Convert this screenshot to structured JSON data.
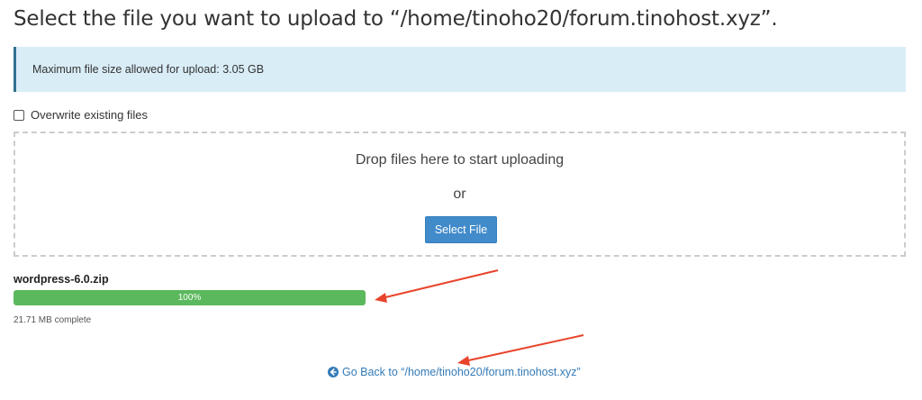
{
  "header": {
    "title": "Select the file you want to upload to “/home/tinoho20/forum.tinohost.xyz”."
  },
  "info": {
    "max_size_text": "Maximum file size allowed for upload: 3.05 GB"
  },
  "options": {
    "overwrite_label": "Overwrite existing files",
    "overwrite_checked": false
  },
  "dropzone": {
    "drop_text": "Drop files here to start uploading",
    "or_text": "or",
    "select_button": "Select File"
  },
  "upload": {
    "file_name": "wordpress-6.0.zip",
    "progress_percent": 100,
    "progress_label": "100%",
    "status": "21.71 MB complete"
  },
  "footer": {
    "go_back_text": "Go Back to “/home/tinoho20/forum.tinohost.xyz”",
    "icon": "arrow-circle-left-icon"
  },
  "colors": {
    "info_bg": "#d9edf7",
    "info_border": "#31708f",
    "button_bg": "#428bca",
    "progress_fill": "#5cb85c",
    "link": "#337ab7",
    "annotation_arrow": "#e8442b"
  }
}
